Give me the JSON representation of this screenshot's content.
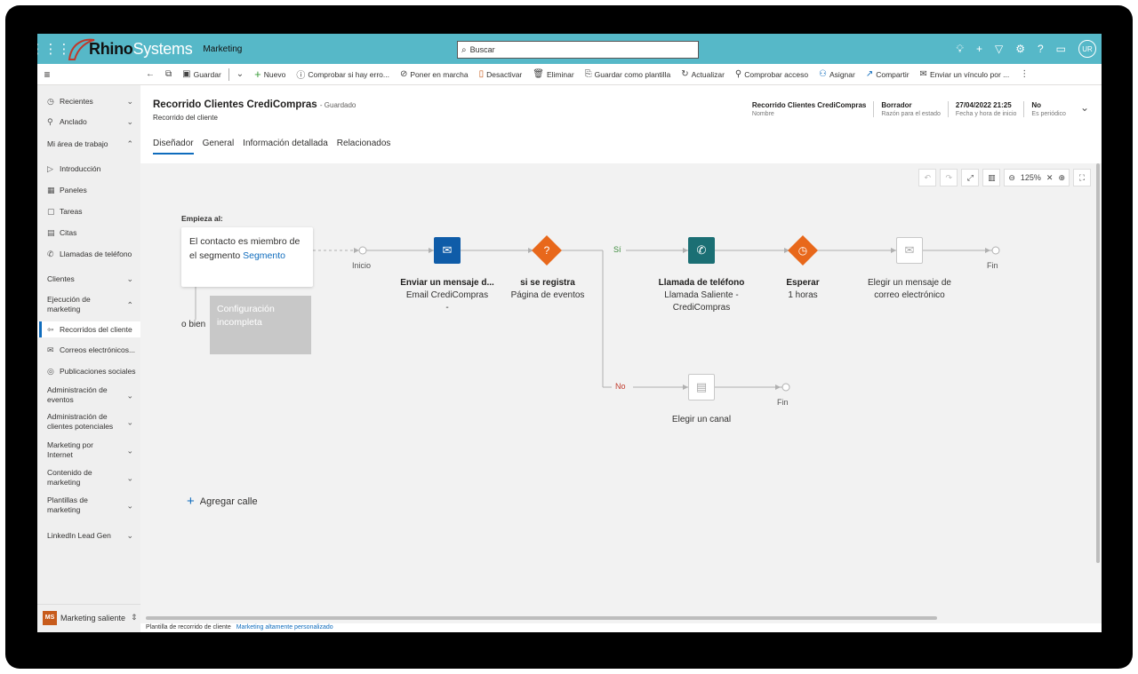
{
  "topbar": {
    "brand_bold": "Rhino",
    "brand_light": "Systems",
    "app_name": "Marketing",
    "search_placeholder": "Buscar",
    "avatar": "UR",
    "accent": "#56b8c8"
  },
  "commandbar": {
    "save": "Guardar",
    "new": "Nuevo",
    "check_errors": "Comprobar si hay erro...",
    "go_live": "Poner en marcha",
    "deactivate": "Desactivar",
    "delete": "Eliminar",
    "save_template": "Guardar como plantilla",
    "refresh": "Actualizar",
    "check_access": "Comprobar acceso",
    "assign": "Asignar",
    "share": "Compartir",
    "send_link": "Enviar un vínculo por ..."
  },
  "nav": {
    "recent": "Recientes",
    "pinned": "Anclado",
    "workspace": "Mi área de trabajo",
    "intro": "Introducción",
    "dashboards": "Paneles",
    "tasks": "Tareas",
    "appointments": "Citas",
    "phone_calls": "Llamadas de teléfono",
    "clients": "Clientes",
    "marketing_exec": "Ejecución de marketing",
    "journeys": "Recorridos del cliente",
    "emails": "Correos electrónicos...",
    "social": "Publicaciones sociales",
    "events_admin": "Administración de eventos",
    "leads_admin": "Administración de clientes potenciales",
    "internet_marketing": "Marketing por Internet",
    "marketing_content": "Contenido de marketing",
    "marketing_templates": "Plantillas de marketing",
    "linkedin": "LinkedIn Lead Gen",
    "area_badge": "MS",
    "area_name": "Marketing saliente"
  },
  "record": {
    "title": "Recorrido Clientes CrediCompras",
    "saved_status": "- Guardado",
    "entity": "Recorrido del cliente",
    "fields": [
      {
        "value": "Recorrido Clientes CrediCompras",
        "label": "Nombre"
      },
      {
        "value": "Borrador",
        "label": "Razón para el estado"
      },
      {
        "value": "27/04/2022 21:25",
        "label": "Fecha y hora de inicio"
      },
      {
        "value": "No",
        "label": "Es periódico"
      }
    ],
    "tabs": [
      "Diseñador",
      "General",
      "Información detallada",
      "Relacionados"
    ]
  },
  "canvas": {
    "zoom": "125%",
    "start_label": "Empieza al:",
    "start_text": "El contacto es miembro de el segmento",
    "start_link": "Segmento",
    "or_label": "o bien",
    "incomplete_label": "Configuración incompleta",
    "start_node_label": "Inicio",
    "nodes": [
      {
        "title": "Enviar un mensaje d...",
        "sub": "Email CrediCompras",
        "sub2": "-"
      },
      {
        "title": "si se registra",
        "sub": "Página de eventos"
      },
      {
        "title": "Llamada de teléfono",
        "sub": "Llamada Saliente -",
        "sub2": "CrediCompras"
      },
      {
        "title": "Esperar",
        "sub": "1 horas"
      }
    ],
    "choose_email": "Elegir un mensaje de correo electrónico",
    "choose_channel": "Elegir un canal",
    "yes_label": "Sí",
    "no_label": "No",
    "end_label": "Fin",
    "add_lane": "Agregar calle"
  },
  "footer": {
    "template_label": "Plantilla de recorrido de cliente",
    "template_link": "Marketing altamente personalizado"
  }
}
